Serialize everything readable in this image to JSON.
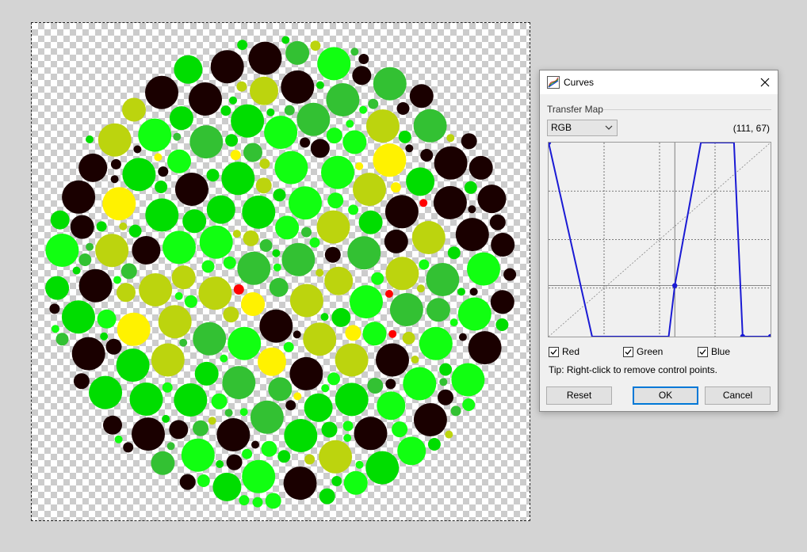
{
  "dialog": {
    "title": "Curves",
    "group_label": "Transfer Map",
    "mode_select": "RGB",
    "coords_readout": "(111, 67)",
    "channels": [
      {
        "label": "Red",
        "checked": true
      },
      {
        "label": "Green",
        "checked": true
      },
      {
        "label": "Blue",
        "checked": true
      }
    ],
    "tip": "Tip: Right-click to remove control points.",
    "buttons": {
      "reset": "Reset",
      "ok": "OK",
      "cancel": "Cancel"
    },
    "curve_color": "#1a1ad4",
    "curve": {
      "control_points": [
        [
          0,
          255
        ],
        [
          50,
          0
        ],
        [
          138,
          0
        ],
        [
          145,
          67
        ],
        [
          175,
          255
        ],
        [
          213,
          255
        ],
        [
          223,
          0
        ],
        [
          255,
          0
        ]
      ],
      "markers": [
        [
          0,
          255
        ],
        [
          145,
          67
        ],
        [
          223,
          0
        ],
        [
          255,
          0
        ]
      ]
    }
  },
  "canvas": {
    "image": "color-blindness-test-plate",
    "colors": {
      "dark": "#1a0000",
      "green": "#00dd00",
      "bright_green": "#11ff11",
      "mid_green": "#33c133",
      "yellow_green": "#bcd40e",
      "yellow": "#fff200",
      "red": "#ff0000"
    }
  }
}
